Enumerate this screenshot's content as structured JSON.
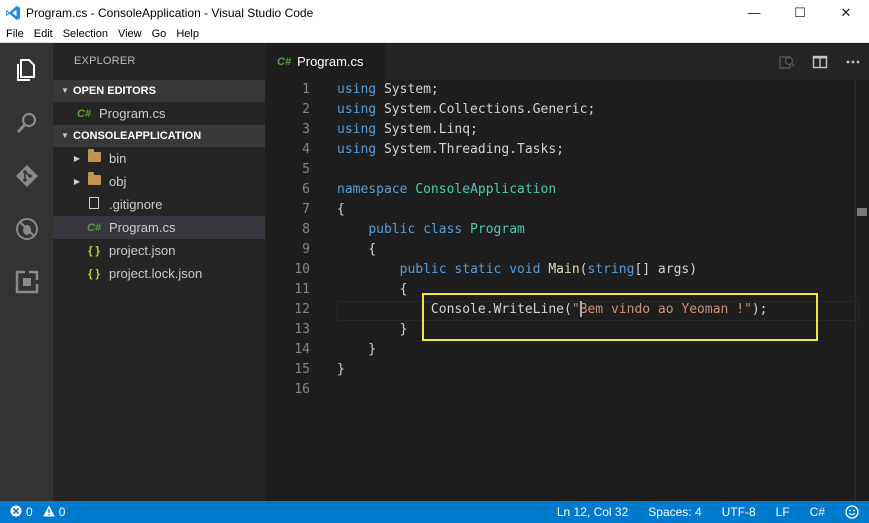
{
  "window": {
    "title": "Program.cs - ConsoleApplication - Visual Studio Code",
    "minimize": "—",
    "maximize": "☐",
    "close": "✕"
  },
  "menu": [
    "File",
    "Edit",
    "Selection",
    "View",
    "Go",
    "Help"
  ],
  "activity_bar": [
    "explorer-icon",
    "search-icon",
    "git-icon",
    "debug-icon",
    "extensions-icon"
  ],
  "sidebar": {
    "title": "EXPLORER",
    "open_editors": {
      "label": "OPEN EDITORS",
      "items": [
        {
          "name": "Program.cs",
          "icon": "C#"
        }
      ]
    },
    "project": {
      "label": "CONSOLEAPPLICATION",
      "items": [
        {
          "name": "bin",
          "type": "folder"
        },
        {
          "name": "obj",
          "type": "folder"
        },
        {
          "name": ".gitignore",
          "type": "file"
        },
        {
          "name": "Program.cs",
          "type": "csharp",
          "icon": "C#"
        },
        {
          "name": "project.json",
          "type": "json",
          "icon": "{ }"
        },
        {
          "name": "project.lock.json",
          "type": "json",
          "icon": "{ }"
        }
      ]
    }
  },
  "editor": {
    "tab": {
      "label": "Program.cs",
      "icon": "C#"
    },
    "line_numbers": [
      "1",
      "2",
      "3",
      "4",
      "5",
      "6",
      "7",
      "8",
      "9",
      "10",
      "11",
      "12",
      "13",
      "14",
      "15",
      "16"
    ],
    "lines": {
      "l1_kw": "using",
      "l1_rest": " System;",
      "l2_kw": "using",
      "l2_rest": " System.Collections.Generic;",
      "l3_kw": "using",
      "l3_rest": " System.Linq;",
      "l4_kw": "using",
      "l4_rest": " System.Threading.Tasks;",
      "l6_kw": "namespace",
      "l6_name": " ConsoleApplication",
      "l7": "{",
      "l8_indent": "    ",
      "l8_kw": "public class",
      "l8_name": " Program",
      "l9": "    {",
      "l10_indent": "        ",
      "l10_kw": "public static void",
      "l10_fn": " Main",
      "l10_p1": "(",
      "l10_ty": "string",
      "l10_p2": "[] args)",
      "l11": "        {",
      "l12_indent": "            ",
      "l12_obj": "Console.",
      "l12_fn": "WriteLine",
      "l12_p1": "(",
      "l12_q": "\"",
      "l12_str": "Bem vindo ao Yeoman !\"",
      "l12_end": ");",
      "l13": "        }",
      "l14": "    }",
      "l15": "}"
    }
  },
  "status": {
    "errors": "0",
    "warnings": "0",
    "position": "Ln 12, Col 32",
    "spaces": "Spaces: 4",
    "encoding": "UTF-8",
    "eol": "LF",
    "language": "C#"
  },
  "colors": {
    "accent": "#007acc",
    "highlight_box": "#f0ea3c",
    "keyword": "#569cd6",
    "type": "#4ec9b0",
    "string": "#ce9178"
  }
}
